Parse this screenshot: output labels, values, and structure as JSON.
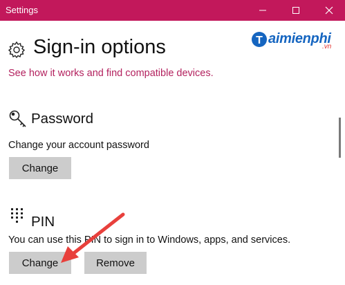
{
  "window": {
    "title": "Settings"
  },
  "page": {
    "title": "Sign-in options"
  },
  "link_text": "See how it works and find compatible devices.",
  "password": {
    "title": "Password",
    "description": "Change your account password",
    "change_label": "Change"
  },
  "pin": {
    "title": "PIN",
    "description": "You can use this PIN to sign in to Windows, apps, and services.",
    "change_label": "Change",
    "remove_label": "Remove"
  },
  "watermark": {
    "text": "aimienphi",
    "suffix": ".vn"
  },
  "colors": {
    "titlebar": "#c2185b",
    "link": "#b3215e",
    "button": "#cccccc",
    "arrow": "#e8403c"
  }
}
